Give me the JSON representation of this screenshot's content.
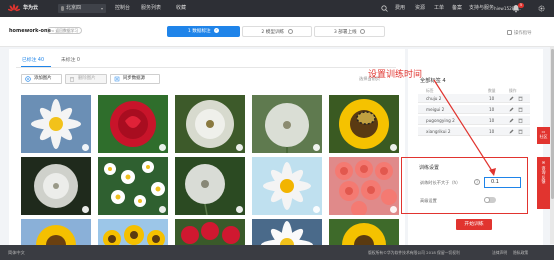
{
  "topbar": {
    "brand": "华为云",
    "region": "北京四",
    "nav": [
      "控制台",
      "服务列表",
      "收藏"
    ],
    "right": [
      "费用",
      "资源",
      "工单",
      "备案",
      "支持与服务",
      "hiew15281..."
    ],
    "notification_count": "5"
  },
  "project": {
    "title": "homework-one",
    "back_label": "< 返回数据学习"
  },
  "steps": [
    {
      "label": "1 数据标注",
      "active": true
    },
    {
      "label": "2 模型训练",
      "active": false
    },
    {
      "label": "3 部署上线",
      "active": false
    }
  ],
  "guide_label": "操作指导",
  "tabs": {
    "labeled": "已标注 40",
    "unlabeled": "未标注 0"
  },
  "actions": {
    "add": "添加图片",
    "delete": "删除图片",
    "sync": "同步数据源"
  },
  "bg_tag": "选择当前页",
  "annotation_overlay": "设置训练时间",
  "labels_panel": {
    "title": "全部标签 4",
    "headers": {
      "label": "标签",
      "count": "数量",
      "op": "操作"
    },
    "rows": [
      {
        "name": "chuju 2",
        "count": "10"
      },
      {
        "name": "meigui 2",
        "count": "10"
      },
      {
        "name": "pugongying 2",
        "count": "10"
      },
      {
        "name": "xiangrikui 2",
        "count": "10"
      }
    ]
  },
  "training": {
    "title": "训练设置",
    "duration_label": "训练时长不大于（h）",
    "duration_value": "0.1",
    "help": "?",
    "advanced_label": "高级设置",
    "train_button": "开始训练"
  },
  "side_tabs": [
    "社区",
    "咨询·反馈"
  ],
  "status": {
    "left": "简体中文",
    "right": "版权所有©华为软件技术有限公司 2018 保留一切权利",
    "links": "法律声明",
    "privacy": "隐私政策"
  },
  "colors": {
    "accent": "#1f84e9",
    "danger": "#e1342f",
    "topbar": "#2d2f35"
  },
  "images": [
    "daisy-white",
    "rose-red",
    "dandelion",
    "dandelion",
    "sunflower-bee",
    "dandelion",
    "daisy-field",
    "dandelion",
    "daisy-pink",
    "rose-pink-bouquet",
    "sunflower",
    "sunflower-field",
    "rose-red",
    "daisy-white",
    "sunflower"
  ]
}
